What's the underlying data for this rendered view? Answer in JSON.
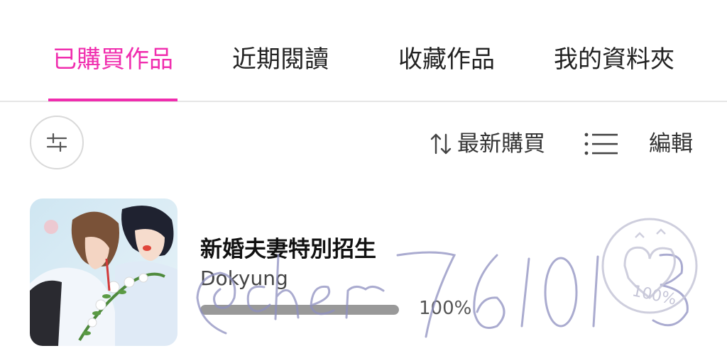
{
  "tabs": [
    {
      "label": "已購買作品",
      "active": true
    },
    {
      "label": "近期閱讀",
      "active": false
    },
    {
      "label": "收藏作品",
      "active": false
    },
    {
      "label": "我的資料夾",
      "active": false
    }
  ],
  "toolbar": {
    "filter_icon": "sliders-icon",
    "sort_icon": "sort-arrows-icon",
    "sort_label": "最新購買",
    "view_icon": "list-view-icon",
    "edit_label": "編輯"
  },
  "colors": {
    "accent": "#f02dae",
    "progress": "#999999",
    "watermark": "#8e8fc0"
  },
  "items": [
    {
      "title": "新婚夫妻特別招生",
      "author": "Dokyung",
      "progress": 1.0,
      "progress_label": "100%"
    }
  ],
  "watermark": {
    "signature_text": "@cher761013",
    "stamp_text": "100%"
  }
}
